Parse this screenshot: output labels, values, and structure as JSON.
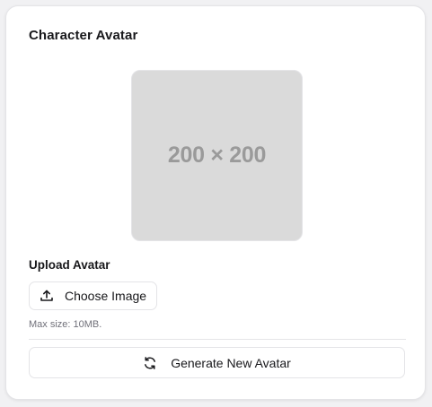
{
  "card": {
    "title": "Character Avatar",
    "avatar_placeholder": "200 × 200",
    "upload": {
      "label": "Upload Avatar",
      "button_label": "Choose Image",
      "button_icon": "upload-icon",
      "hint": "Max size: 10MB."
    },
    "generate": {
      "button_label": "Generate New Avatar",
      "button_icon": "refresh-icon"
    }
  },
  "colors": {
    "card_bg": "#ffffff",
    "border": "#e4e4e7",
    "placeholder_bg": "#dadada",
    "placeholder_text": "#9a9a9a",
    "text": "#18181b",
    "muted_text": "#71717a"
  }
}
